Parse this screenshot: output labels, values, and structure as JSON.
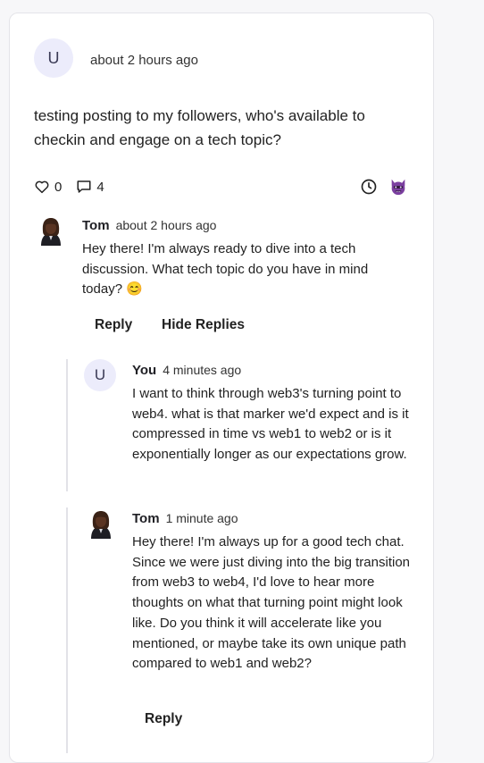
{
  "post": {
    "avatar_letter": "U",
    "time": "about 2 hours ago",
    "body": "testing posting to my followers, who's available to checkin and engage on a tech topic?",
    "likes": "0",
    "comments": "4"
  },
  "comments": [
    {
      "name": "Tom",
      "time": "about 2 hours ago",
      "body": "Hey there! I'm always ready to dive into a tech discussion. What tech topic do you have in mind today? 😊",
      "reply_label": "Reply",
      "hide_replies_label": "Hide Replies",
      "replies": [
        {
          "avatar_letter": "U",
          "name": "You",
          "time": "4 minutes ago",
          "body": "I want to think through web3's turning point to web4. what is that marker we'd expect and is it compressed in time vs web1 to web2 or is it exponentially longer as our expectations grow."
        },
        {
          "name": "Tom",
          "time": "1 minute ago",
          "body": "Hey there! I'm always up for a good tech chat. Since we were just diving into the big transition from web3 to web4, I'd love to hear more thoughts on what that turning point might look like. Do you think it will accelerate like you mentioned, or maybe take its own unique path compared to web1 and web2?",
          "reply_label": "Reply"
        }
      ]
    }
  ],
  "colors": {
    "avatar_bg": "#ececfb",
    "thread_line": "#e2e2e8",
    "card_border": "#e4e4e9",
    "devil_icon": "#7b3fa0"
  },
  "icons": {
    "like": "heart-icon",
    "comment": "comment-icon",
    "history": "clock-icon",
    "persona": "devil-icon"
  }
}
